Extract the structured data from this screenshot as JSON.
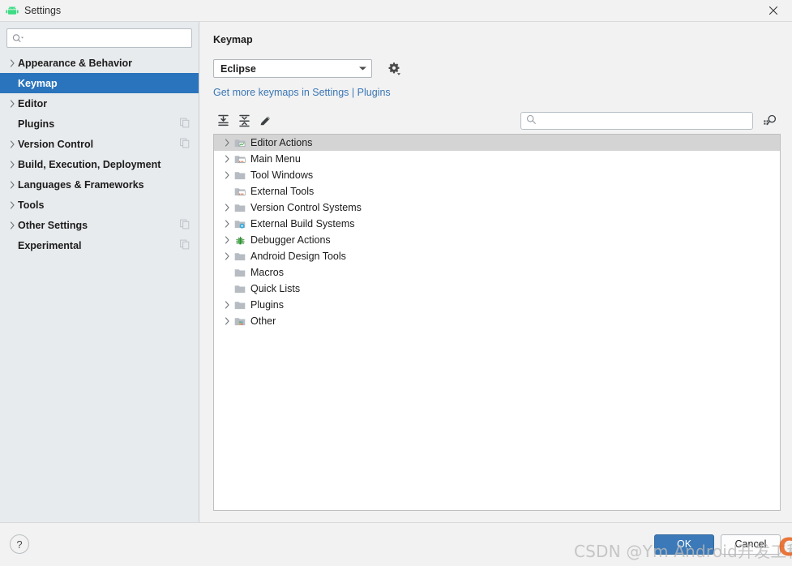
{
  "window": {
    "title": "Settings",
    "app_icon": "android-icon",
    "close_icon": "close-icon"
  },
  "sidebar": {
    "search": {
      "value": "",
      "placeholder": "",
      "icon": "search-icon"
    },
    "items": [
      {
        "label": "Appearance & Behavior",
        "arrow": true,
        "selected": false,
        "copy_icon": false
      },
      {
        "label": "Keymap",
        "arrow": false,
        "selected": true,
        "copy_icon": false
      },
      {
        "label": "Editor",
        "arrow": true,
        "selected": false,
        "copy_icon": false
      },
      {
        "label": "Plugins",
        "arrow": false,
        "selected": false,
        "copy_icon": true
      },
      {
        "label": "Version Control",
        "arrow": true,
        "selected": false,
        "copy_icon": true
      },
      {
        "label": "Build, Execution, Deployment",
        "arrow": true,
        "selected": false,
        "copy_icon": false
      },
      {
        "label": "Languages & Frameworks",
        "arrow": true,
        "selected": false,
        "copy_icon": false
      },
      {
        "label": "Tools",
        "arrow": true,
        "selected": false,
        "copy_icon": false
      },
      {
        "label": "Other Settings",
        "arrow": true,
        "selected": false,
        "copy_icon": true
      },
      {
        "label": "Experimental",
        "arrow": false,
        "selected": false,
        "copy_icon": true
      }
    ]
  },
  "main": {
    "title": "Keymap",
    "keymap_select": {
      "value": "Eclipse",
      "arrow_icon": "chevron-down-icon"
    },
    "gear_icon": "gear-icon",
    "link": {
      "prefix": "Get more keymaps in Settings",
      "separator": "|",
      "suffix": "Plugins"
    },
    "toolbar": {
      "expand_all_icon": "expand-all-icon",
      "collapse_all_icon": "collapse-all-icon",
      "edit_icon": "pencil-icon",
      "filter": {
        "value": "",
        "placeholder": "",
        "icon": "search-icon"
      },
      "find_shortcut_icon": "find-by-shortcut-icon"
    },
    "tree": [
      {
        "label": "Editor Actions",
        "arrow": true,
        "selected": true,
        "icon": "editor-actions-icon"
      },
      {
        "label": "Main Menu",
        "arrow": true,
        "selected": false,
        "icon": "main-menu-icon"
      },
      {
        "label": "Tool Windows",
        "arrow": true,
        "selected": false,
        "icon": "folder-icon"
      },
      {
        "label": "External Tools",
        "arrow": false,
        "selected": false,
        "icon": "external-tools-icon"
      },
      {
        "label": "Version Control Systems",
        "arrow": true,
        "selected": false,
        "icon": "folder-icon"
      },
      {
        "label": "External Build Systems",
        "arrow": true,
        "selected": false,
        "icon": "external-build-icon"
      },
      {
        "label": "Debugger Actions",
        "arrow": true,
        "selected": false,
        "icon": "bug-icon"
      },
      {
        "label": "Android Design Tools",
        "arrow": true,
        "selected": false,
        "icon": "folder-icon"
      },
      {
        "label": "Macros",
        "arrow": false,
        "selected": false,
        "icon": "folder-icon"
      },
      {
        "label": "Quick Lists",
        "arrow": false,
        "selected": false,
        "icon": "folder-icon"
      },
      {
        "label": "Plugins",
        "arrow": true,
        "selected": false,
        "icon": "folder-icon"
      },
      {
        "label": "Other",
        "arrow": true,
        "selected": false,
        "icon": "other-icon"
      }
    ]
  },
  "footer": {
    "help_label": "?",
    "ok_label": "OK",
    "cancel_label": "Cancel"
  },
  "watermark": {
    "text": "CSDN @Ym Android开发工程师",
    "logo": "C"
  },
  "colors": {
    "accent": "#2a74bd",
    "link": "#3a76b4",
    "sidebar_bg": "#e8ebed",
    "panel_bg": "#f2f2f2",
    "tree_selection": "#d4d4d4",
    "primary_button": "#3b79b8",
    "watermark": "#b9b9b9",
    "csdn_logo": "#e8601c"
  }
}
